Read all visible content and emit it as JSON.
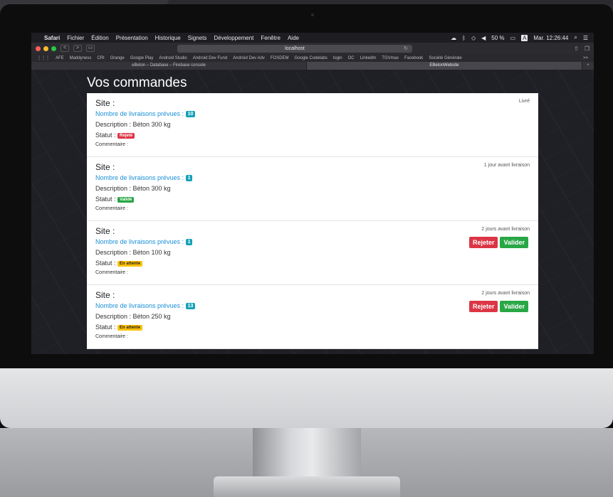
{
  "menubar": {
    "apple": "",
    "items": [
      "Safari",
      "Fichier",
      "Édition",
      "Présentation",
      "Historique",
      "Signets",
      "Développement",
      "Fenêtre",
      "Aide"
    ],
    "battery": "50 %",
    "input_source": "A",
    "clock": "Mar. 12:26:44"
  },
  "toolbar": {
    "back": "<",
    "forward": ">",
    "url": "localhost"
  },
  "bookmarks": [
    "AFE",
    "Maddyness",
    "CRI",
    "Orange",
    "Google Play",
    "Android Studio",
    "Android Dev Fund",
    "Android Dev Adv",
    "FOSDEM",
    "Google Codelabs",
    "login",
    "OC",
    "LinkedIn",
    "TGVmax",
    "Facebook",
    "Société Générale"
  ],
  "bookmarks_more": ">>",
  "tabs": [
    {
      "label": "eBeton – Database – Firebase console"
    },
    {
      "label": "EBetonWebsite"
    }
  ],
  "page": {
    "title": "Vos commandes",
    "orders": [
      {
        "site": "Site :",
        "deliveries_label": "Nombre de livraisons prévues :",
        "deliveries_count": "10",
        "description": "Description : Béton 300 kg",
        "status_label": "Statut :",
        "status": "Rejeté",
        "status_color": "red",
        "comment": "Commentaire :",
        "right_text": "Livré",
        "actions": false
      },
      {
        "site": "Site :",
        "deliveries_label": "Nombre de livraisons prévues :",
        "deliveries_count": "1",
        "description": "Description : Béton 300 kg",
        "status_label": "Statut :",
        "status": "Validé",
        "status_color": "green",
        "comment": "Commentaire :",
        "right_text": "1 jour avant livraison",
        "actions": false
      },
      {
        "site": "Site :",
        "deliveries_label": "Nombre de livraisons prévues :",
        "deliveries_count": "1",
        "description": "Description : Béton 100 kg",
        "status_label": "Statut :",
        "status": "En attente",
        "status_color": "yellow",
        "comment": "Commentaire :",
        "right_text": "2 jours avant livraison",
        "actions": true,
        "reject_label": "Rejeter",
        "validate_label": "Valider"
      },
      {
        "site": "Site :",
        "deliveries_label": "Nombre de livraisons prévues :",
        "deliveries_count": "13",
        "description": "Description : Béton 250 kg",
        "status_label": "Statut :",
        "status": "En attente",
        "status_color": "yellow",
        "comment": "Commentaire :",
        "right_text": "2 jours avant livraison",
        "actions": true,
        "reject_label": "Rejeter",
        "validate_label": "Valider"
      }
    ]
  },
  "colors": {
    "deliveries_text": "#1a8fd6",
    "badge_red": "#dc3545",
    "badge_green": "#28a745",
    "badge_yellow": "#ffc107",
    "count_pill": "#17a2b8"
  }
}
